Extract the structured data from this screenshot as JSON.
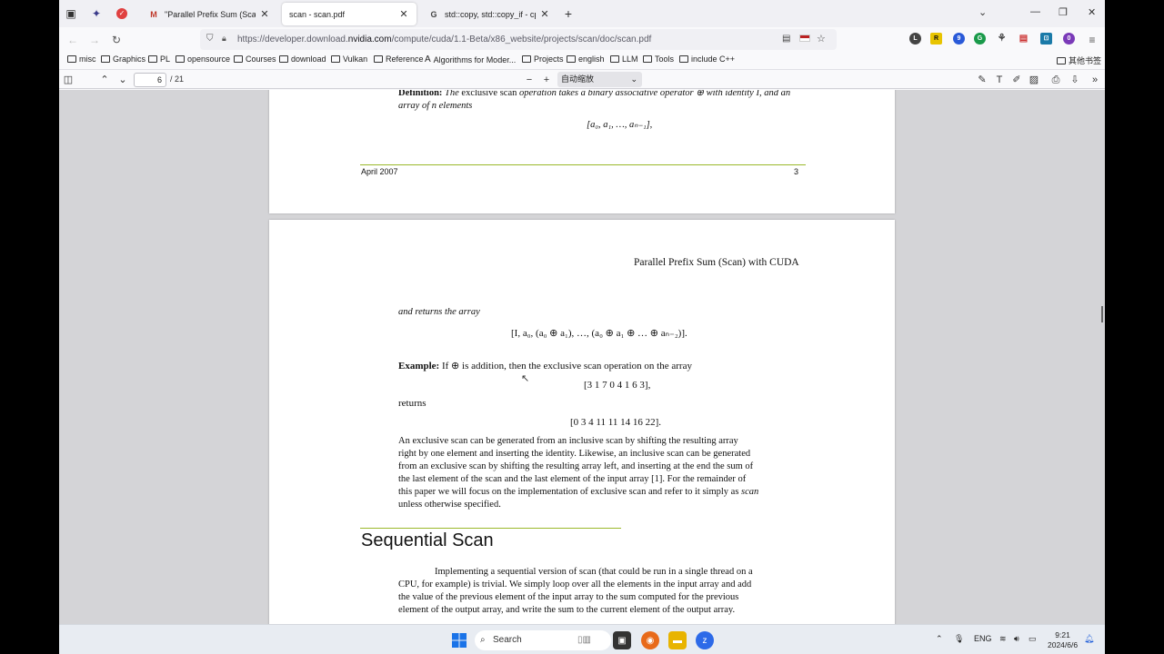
{
  "tabs": [
    {
      "title": "\"Parallel Prefix Sum (Scan) with CUDA\"",
      "favicon": "mendeley-icon",
      "active": false
    },
    {
      "title": "scan - scan.pdf",
      "favicon": "",
      "active": true
    },
    {
      "title": "std::copy, std::copy_if - cppreference.com",
      "favicon": "cppreference-icon",
      "active": false
    }
  ],
  "nav": {
    "url_prefix": "https://developer.download.",
    "url_domain": "nvidia.com",
    "url_path": "/compute/cuda/1.1-Beta/x86_website/projects/scan/doc/scan.pdf"
  },
  "extensions": {
    "badge_1": "9",
    "badge_2": "0",
    "r_label": "R",
    "l_label": "L"
  },
  "bookmarks": [
    "misc",
    "Graphics",
    "PL",
    "opensource",
    "Courses",
    "download",
    "Vulkan",
    "Reference",
    "Algorithms for Moder...",
    "Projects",
    "english",
    "LLM",
    "Tools",
    "include C++"
  ],
  "other_bookmarks": "其他书签",
  "pdf_toolbar": {
    "page_number": "6",
    "page_total": "/ 21",
    "zoom": "自动缩放"
  },
  "page5": {
    "definition_label": "Definition:",
    "definition_text_1a": "The",
    "definition_text_1b": "exclusive scan",
    "definition_text_1c": "operation takes a binary associative operator ⊕ with identity I, and an",
    "definition_text_2": "array of n elements",
    "array_formula": "[a₀, a₁, …, aₙ₋₁],",
    "footer_left": "April 2007",
    "footer_right": "3"
  },
  "page6": {
    "header": "Parallel Prefix Sum (Scan) with CUDA",
    "returns_array": "and returns the array",
    "exclusive_formula": "[I, a₀, (a₀ ⊕ a₁), …, (a₀ ⊕ a₁ ⊕ … ⊕ aₙ₋₂)].",
    "example_label": "Example:",
    "example_text": "If ⊕ is addition, then the exclusive scan operation on the array",
    "example_input": "[3 1 7 0 4 1 6 3],",
    "returns": "returns",
    "example_output": "[0 3 4 11 11 14 16 22].",
    "para_lines": [
      "An exclusive scan can be generated from an inclusive scan by shifting the resulting array",
      "right by one element and inserting the identity.  Likewise, an inclusive scan can be generated",
      "from an exclusive scan by shifting the resulting array left, and inserting at the end the sum of",
      "the last element of the scan and the last element of the input array [1].  For the remainder of",
      "this paper we will focus on the implementation of exclusive scan and refer to it simply as",
      "unless otherwise specified."
    ],
    "para_scan_word": "scan",
    "section_title": "Sequential Scan",
    "seq_lines": [
      "Implementing a sequential version of scan (that could be run in a single thread on a",
      "CPU, for example) is trivial.  We simply loop over all the elements in the input array and add",
      "the value of the previous element of the input array to the sum computed for the previous",
      "element of the output array, and write the sum to the current element of the output array."
    ]
  },
  "taskbar": {
    "search": "Search",
    "lang": "ENG",
    "time": "9:21",
    "date": "2024/6/6"
  }
}
